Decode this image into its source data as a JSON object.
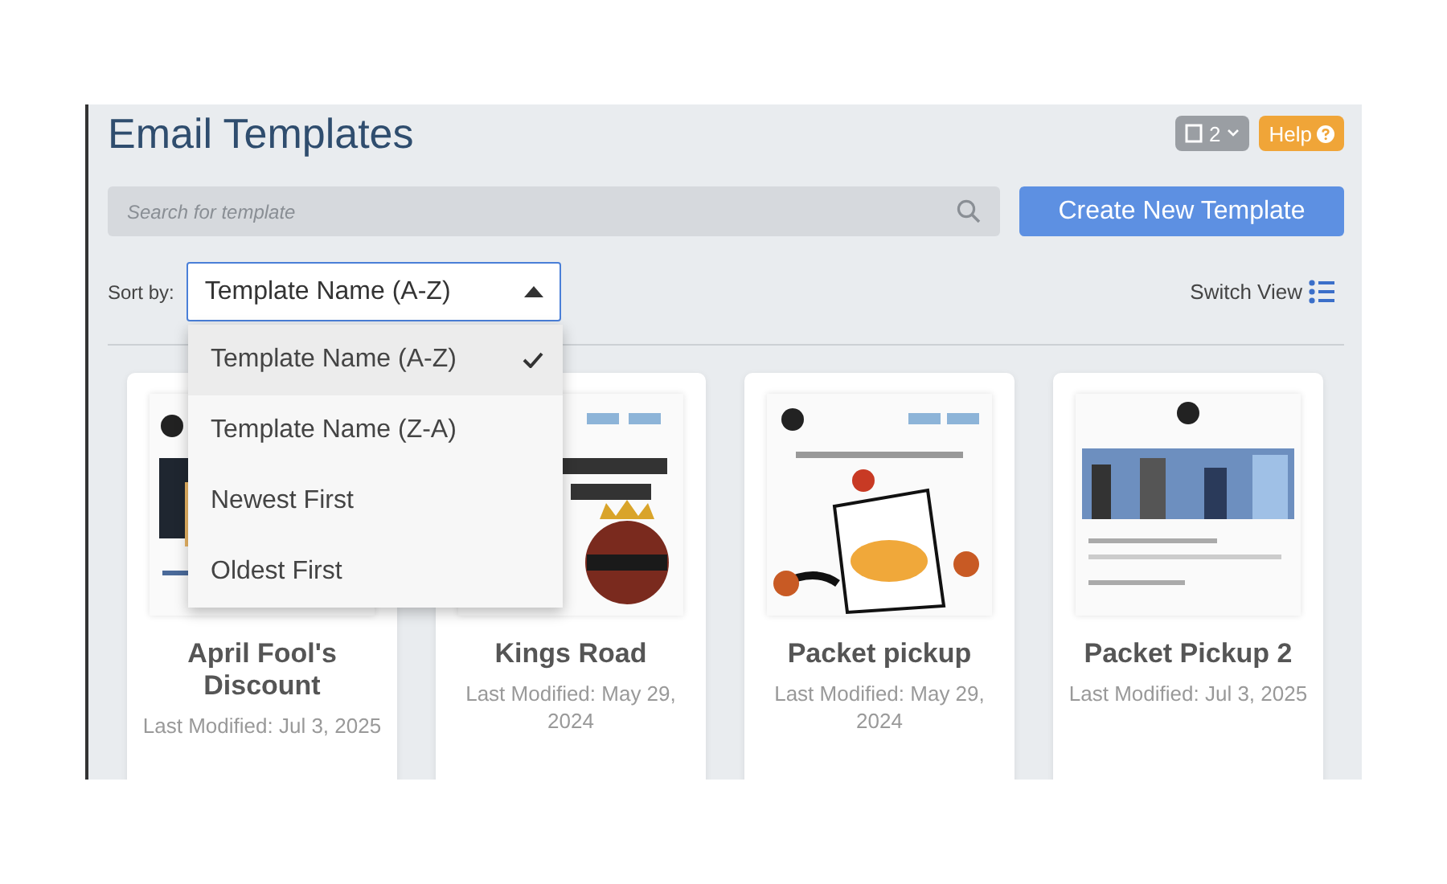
{
  "header": {
    "title": "Email Templates",
    "page_count": "2",
    "help": "Help"
  },
  "search": {
    "placeholder": "Search for template"
  },
  "create_button": "Create New Template",
  "sort": {
    "label": "Sort by:",
    "value": "Template Name (A-Z)",
    "expanded": true,
    "options": [
      {
        "label": "Template Name (A-Z)",
        "selected": true
      },
      {
        "label": "Template Name (Z-A)",
        "selected": false
      },
      {
        "label": "Newest First",
        "selected": false
      },
      {
        "label": "Oldest First",
        "selected": false
      }
    ]
  },
  "switch_view": "Switch View",
  "templates": [
    {
      "name": "April Fool's Discount",
      "modified": "Last Modified: Jul 3, 2025"
    },
    {
      "name": "Kings Road",
      "modified": "Last Modified: May 29, 2024"
    },
    {
      "name": "Packet pickup",
      "modified": "Last Modified: May 29, 2024"
    },
    {
      "name": "Packet Pickup 2",
      "modified": "Last Modified: Jul 3, 2025"
    }
  ]
}
